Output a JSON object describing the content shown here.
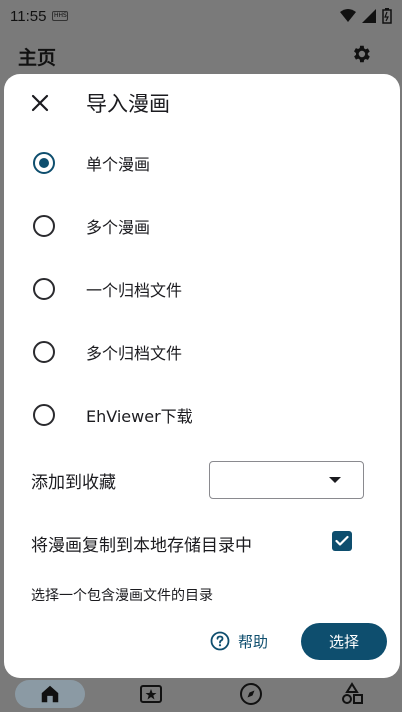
{
  "status_bar": {
    "time": "11:55",
    "badge": "HHS"
  },
  "app_bar": {
    "title": "主页"
  },
  "dialog": {
    "title": "导入漫画",
    "options": [
      {
        "label": "单个漫画",
        "checked": true
      },
      {
        "label": "多个漫画",
        "checked": false
      },
      {
        "label": "一个归档文件",
        "checked": false
      },
      {
        "label": "多个归档文件",
        "checked": false
      },
      {
        "label": "EhViewer下载",
        "checked": false
      }
    ],
    "favorite_label": "添加到收藏",
    "favorite_value": "",
    "copy_label": "将漫画复制到本地存储目录中",
    "copy_checked": true,
    "hint": "选择一个包含漫画文件的目录",
    "help_label": "帮助",
    "select_label": "选择"
  },
  "colors": {
    "accent": "#0e4e6e",
    "scrim": "#7a7a7a",
    "surface": "#ffffff"
  },
  "bottom_nav": [
    "home-icon",
    "ticket-star-icon",
    "compass-icon",
    "shapes-icon"
  ]
}
